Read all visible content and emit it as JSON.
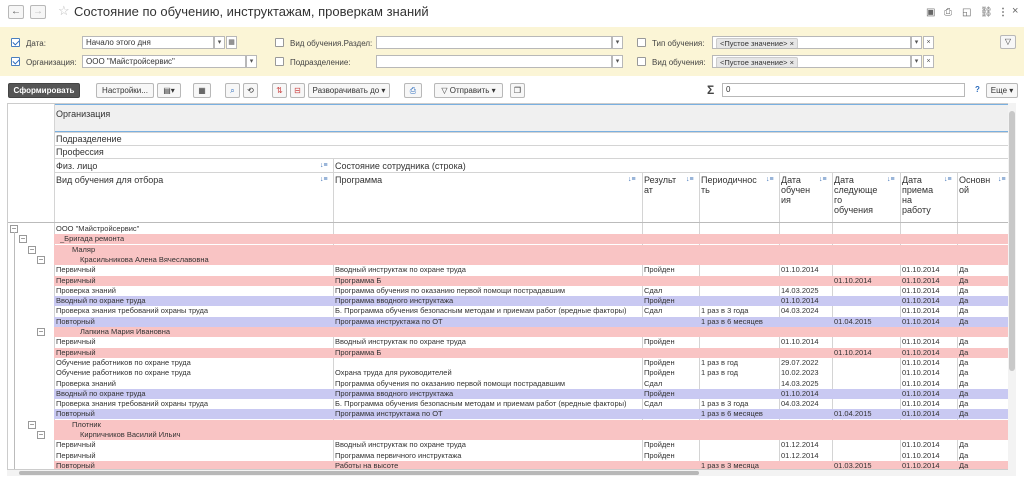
{
  "window": {
    "title": "Состояние по обучению, инструктажам, проверкам знаний"
  },
  "filters": {
    "date": {
      "label": "Дата:",
      "value": "Начало этого дня"
    },
    "org": {
      "label": "Организация:",
      "value": "ООО \"Майстройсервис\""
    },
    "vid_razdel": {
      "label": "Вид обучения.Раздел:",
      "value": ""
    },
    "podrazdelenie": {
      "label": "Подразделение:",
      "value": ""
    },
    "tip": {
      "label": "Тип обучения:",
      "tag": "<Пустое значение>"
    },
    "vid": {
      "label": "Вид обучения:",
      "tag": "<Пустое значение>"
    }
  },
  "toolbar": {
    "generate": "Сформировать",
    "settings": "Настройки...",
    "expand": "Разворачивать до",
    "send": "Отправить",
    "sum_symbol": "Σ",
    "sum_value": "0",
    "help": "?",
    "more": "Еще"
  },
  "headers": {
    "org": "Организация",
    "podr": "Подразделение",
    "prof": "Профессия",
    "fiz": "Физ. лицо",
    "status": "Состояние сотрудника (строка)",
    "vid": "Вид обучения для отбора",
    "program": "Программа",
    "result": [
      "Результ",
      "ат"
    ],
    "period": [
      "Периодичнос",
      "ть"
    ],
    "date_obuch": [
      "Дата",
      "обучен",
      "ия"
    ],
    "date_next": [
      "Дата",
      "следующе",
      "го",
      "обучения"
    ],
    "date_priem": [
      "Дата",
      "приема",
      "на",
      "работу"
    ],
    "osnov": [
      "Основн",
      "ой"
    ]
  },
  "rows": [
    {
      "level": 0,
      "type": "org",
      "name": "ООО \"Майстройсервис\"",
      "bg": ""
    },
    {
      "level": 1,
      "type": "group",
      "name": "_Бригада ремонта",
      "bg": "#f9c4c4"
    },
    {
      "level": 2,
      "type": "group",
      "name": "Маляр",
      "bg": "#f9c4c4"
    },
    {
      "level": 3,
      "type": "group",
      "name": "Красильникова Алена Вячеславовна",
      "bg": "#f9c4c4"
    },
    {
      "type": "data",
      "vid": "Первичный",
      "program": "Вводный инструктаж по охране труда",
      "result": "Пройден",
      "period": "",
      "date_obuch": "01.10.2014",
      "date_next": "",
      "date_priem": "01.10.2014",
      "osnov": "Да",
      "bg": ""
    },
    {
      "type": "data",
      "vid": "Первичный",
      "program": "Программа Б",
      "result": "",
      "period": "",
      "date_obuch": "",
      "date_next": "01.10.2014",
      "date_priem": "01.10.2014",
      "osnov": "Да",
      "bg": "#f9c4c4"
    },
    {
      "type": "data",
      "vid": "Проверка знаний",
      "program": "Программа обучения по оказанию первой помощи пострадавшим",
      "result": "Сдал",
      "period": "",
      "date_obuch": "14.03.2025",
      "date_next": "",
      "date_priem": "01.10.2014",
      "osnov": "Да",
      "bg": ""
    },
    {
      "type": "data",
      "vid": "Вводный по охране труда",
      "program": "Программа вводного инструктажа",
      "result": "Пройден",
      "period": "",
      "date_obuch": "01.10.2014",
      "date_next": "",
      "date_priem": "01.10.2014",
      "osnov": "Да",
      "bg": "#c9c9f2"
    },
    {
      "type": "data",
      "vid": "Проверка знания требований охраны труда",
      "program": "Б. Программа обучения безопасным методам и приемам работ (вредные факторы)",
      "result": "Сдал",
      "period": "1 раз в 3 года",
      "date_obuch": "04.03.2024",
      "date_next": "",
      "date_priem": "01.10.2014",
      "osnov": "Да",
      "bg": ""
    },
    {
      "type": "data",
      "vid": "Повторный",
      "program": "Программа инструктажа по ОТ",
      "result": "",
      "period": "1 раз в 6 месяцев",
      "date_obuch": "",
      "date_next": "01.04.2015",
      "date_priem": "01.10.2014",
      "osnov": "Да",
      "bg": "#c9c9f2"
    },
    {
      "level": 3,
      "type": "group",
      "name": "Лапкина Мария Ивановна",
      "bg": "#f9c4c4"
    },
    {
      "type": "data",
      "vid": "Первичный",
      "program": "Вводный инструктаж по охране труда",
      "result": "Пройден",
      "period": "",
      "date_obuch": "01.10.2014",
      "date_next": "",
      "date_priem": "01.10.2014",
      "osnov": "Да",
      "bg": ""
    },
    {
      "type": "data",
      "vid": "Первичный",
      "program": "Программа Б",
      "result": "",
      "period": "",
      "date_obuch": "",
      "date_next": "01.10.2014",
      "date_priem": "01.10.2014",
      "osnov": "Да",
      "bg": "#f9c4c4"
    },
    {
      "type": "data",
      "vid": "Обучение работников по охране труда",
      "program": "",
      "result": "Пройден",
      "period": "1 раз в год",
      "date_obuch": "29.07.2022",
      "date_next": "",
      "date_priem": "01.10.2014",
      "osnov": "Да",
      "bg": ""
    },
    {
      "type": "data",
      "vid": "Обучение работников по охране труда",
      "program": "Охрана труда для руководителей",
      "result": "Пройден",
      "period": "1 раз в год",
      "date_obuch": "10.02.2023",
      "date_next": "",
      "date_priem": "01.10.2014",
      "osnov": "Да",
      "bg": ""
    },
    {
      "type": "data",
      "vid": "Проверка знаний",
      "program": "Программа обучения по оказанию первой помощи пострадавшим",
      "result": "Сдал",
      "period": "",
      "date_obuch": "14.03.2025",
      "date_next": "",
      "date_priem": "01.10.2014",
      "osnov": "Да",
      "bg": ""
    },
    {
      "type": "data",
      "vid": "Вводный по охране труда",
      "program": "Программа вводного инструктажа",
      "result": "Пройден",
      "period": "",
      "date_obuch": "01.10.2014",
      "date_next": "",
      "date_priem": "01.10.2014",
      "osnov": "Да",
      "bg": "#c9c9f2"
    },
    {
      "type": "data",
      "vid": "Проверка знания требований охраны труда",
      "program": "Б. Программа обучения безопасным методам и приемам работ (вредные факторы)",
      "result": "Сдал",
      "period": "1 раз в 3 года",
      "date_obuch": "04.03.2024",
      "date_next": "",
      "date_priem": "01.10.2014",
      "osnov": "Да",
      "bg": ""
    },
    {
      "type": "data",
      "vid": "Повторный",
      "program": "Программа инструктажа по ОТ",
      "result": "",
      "period": "1 раз в 6 месяцев",
      "date_obuch": "",
      "date_next": "01.04.2015",
      "date_priem": "01.10.2014",
      "osnov": "Да",
      "bg": "#c9c9f2"
    },
    {
      "level": 2,
      "type": "group",
      "name": "Плотник",
      "bg": "#f9c4c4"
    },
    {
      "level": 3,
      "type": "group",
      "name": "Кирпичников Василий Ильич",
      "bg": "#f9c4c4"
    },
    {
      "type": "data",
      "vid": "Первичный",
      "program": "Вводный инструктаж по охране труда",
      "result": "Пройден",
      "period": "",
      "date_obuch": "01.12.2014",
      "date_next": "",
      "date_priem": "01.10.2014",
      "osnov": "Да",
      "bg": ""
    },
    {
      "type": "data",
      "vid": "Первичный",
      "program": "Программа первичного инструктажа",
      "result": "Пройден",
      "period": "",
      "date_obuch": "01.12.2014",
      "date_next": "",
      "date_priem": "01.10.2014",
      "osnov": "Да",
      "bg": ""
    },
    {
      "type": "data",
      "vid": "Повторный",
      "program": "Работы на высоте",
      "result": "",
      "period": "1 раз в 3 месяца",
      "date_obuch": "",
      "date_next": "01.03.2015",
      "date_priem": "01.10.2014",
      "osnov": "Да",
      "bg": "#f9c4c4"
    }
  ]
}
